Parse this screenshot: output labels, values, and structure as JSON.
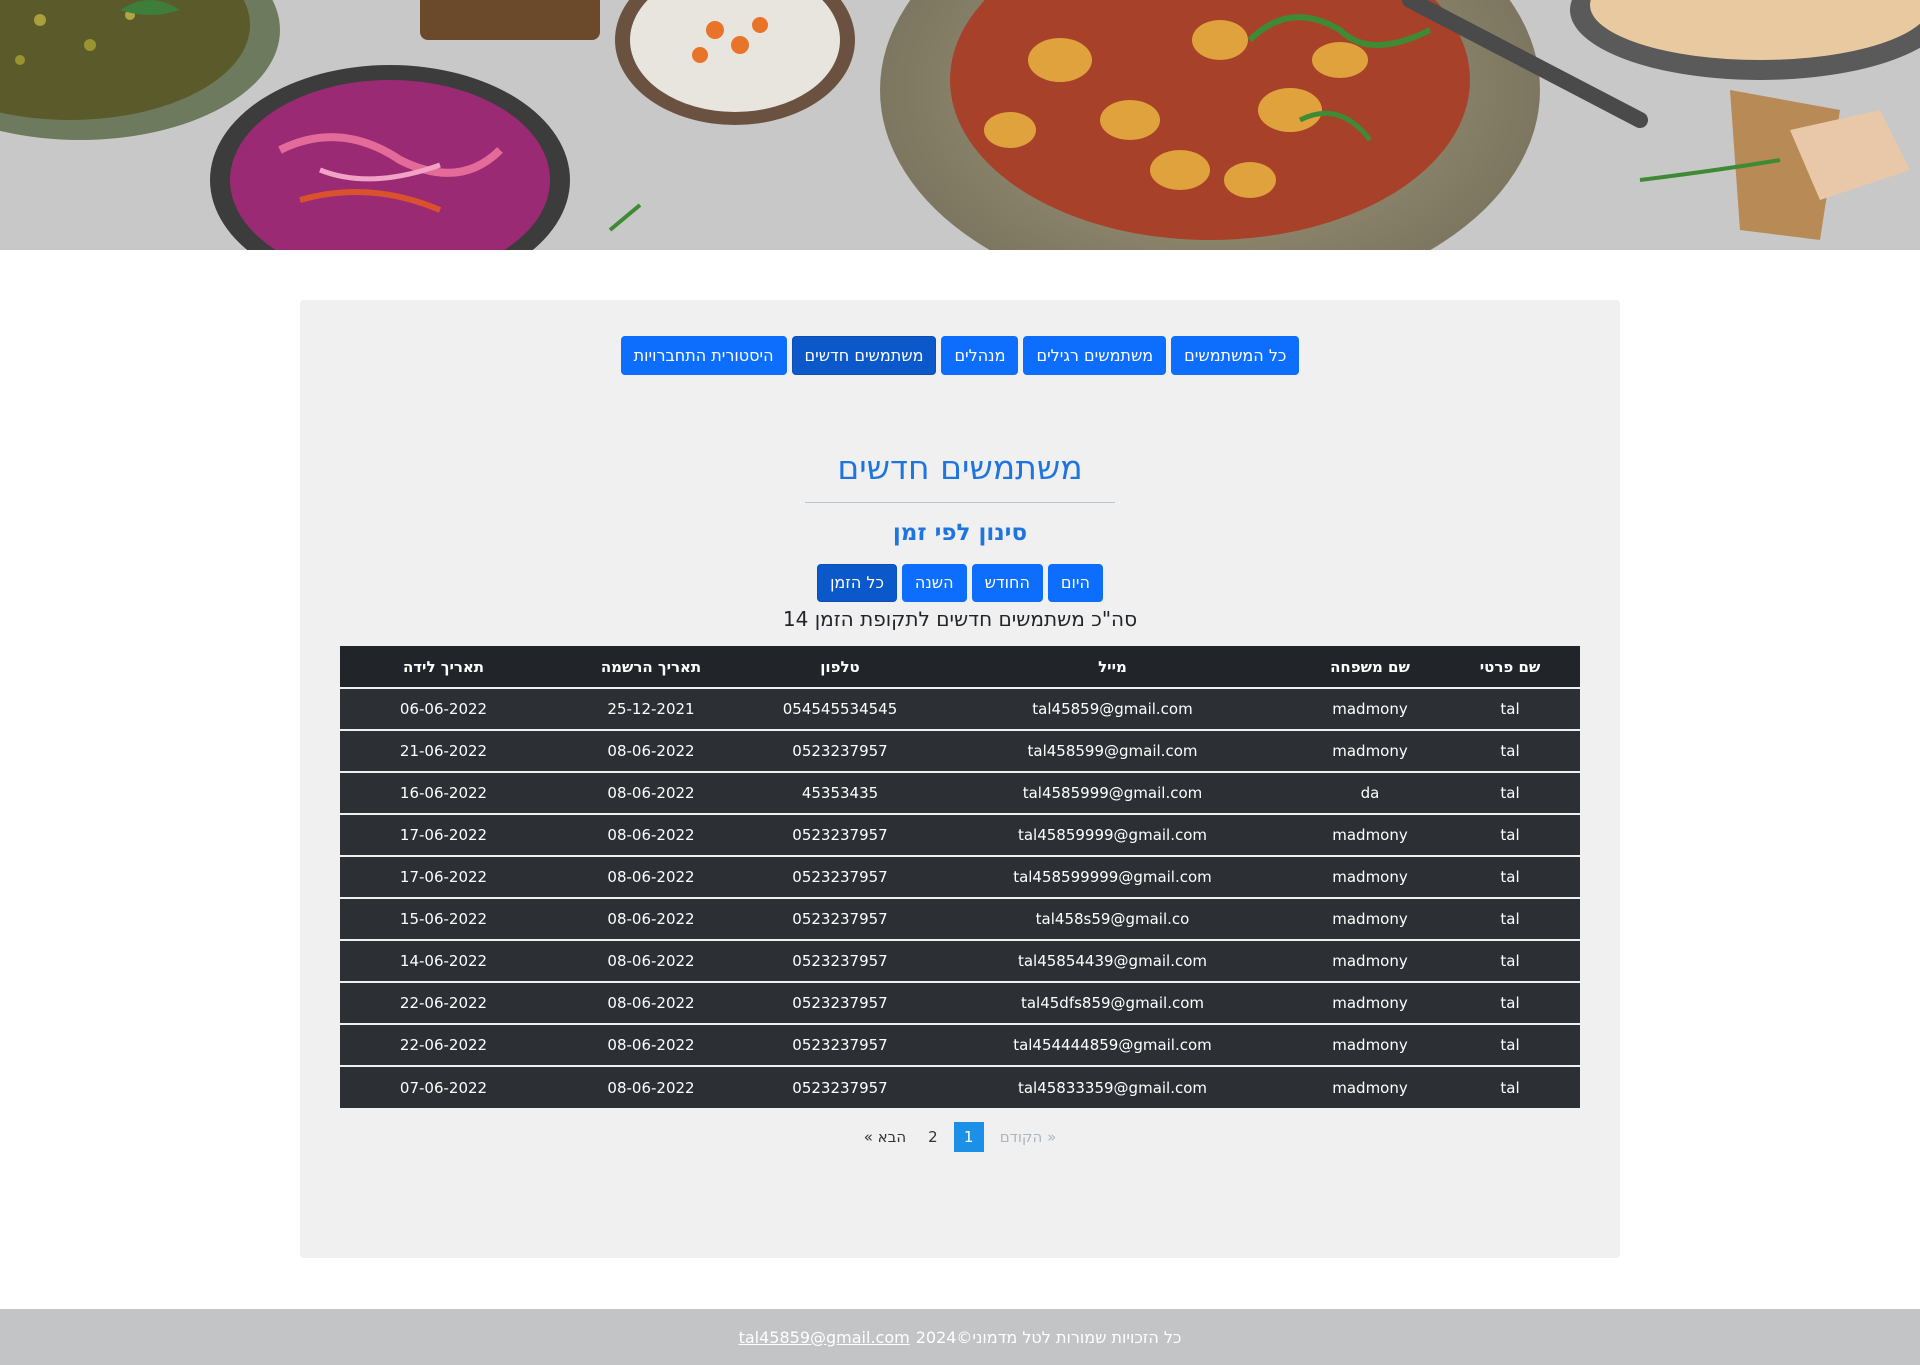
{
  "nav": {
    "items": [
      {
        "label": "כל המשתמשים",
        "active": false
      },
      {
        "label": "משתמשים רגילים",
        "active": false
      },
      {
        "label": "מנהלים",
        "active": false
      },
      {
        "label": "משתמשים חדשים",
        "active": true
      },
      {
        "label": "היסטורית התחברויות",
        "active": false
      }
    ]
  },
  "main": {
    "title": "משתמשים חדשים",
    "filter_title": "סינון לפי זמן",
    "filters": [
      {
        "label": "היום",
        "active": false
      },
      {
        "label": "החודש",
        "active": false
      },
      {
        "label": "השנה",
        "active": false
      },
      {
        "label": "כל הזמן",
        "active": true
      }
    ],
    "summary": "סה\"כ משתמשים חדשים לתקופת הזמן 14"
  },
  "table": {
    "headers": [
      "שם פרטי",
      "שם משפחה",
      "מייל",
      "טלפון",
      "תאריך הרשמה",
      "תאריך לידה"
    ],
    "rows": [
      [
        "tal",
        "madmony",
        "tal45859@gmail.com",
        "054545534545",
        "25-12-2021",
        "06-06-2022"
      ],
      [
        "tal",
        "madmony",
        "tal458599@gmail.com",
        "0523237957",
        "08-06-2022",
        "21-06-2022"
      ],
      [
        "tal",
        "da",
        "tal4585999@gmail.com",
        "45353435",
        "08-06-2022",
        "16-06-2022"
      ],
      [
        "tal",
        "madmony",
        "tal45859999@gmail.com",
        "0523237957",
        "08-06-2022",
        "17-06-2022"
      ],
      [
        "tal",
        "madmony",
        "tal458599999@gmail.com",
        "0523237957",
        "08-06-2022",
        "17-06-2022"
      ],
      [
        "tal",
        "madmony",
        "tal458s59@gmail.co",
        "0523237957",
        "08-06-2022",
        "15-06-2022"
      ],
      [
        "tal",
        "madmony",
        "tal45854439@gmail.com",
        "0523237957",
        "08-06-2022",
        "14-06-2022"
      ],
      [
        "tal",
        "madmony",
        "tal45dfs859@gmail.com",
        "0523237957",
        "08-06-2022",
        "22-06-2022"
      ],
      [
        "tal",
        "madmony",
        "tal454444859@gmail.com",
        "0523237957",
        "08-06-2022",
        "22-06-2022"
      ],
      [
        "tal",
        "madmony",
        "tal45833359@gmail.com",
        "0523237957",
        "08-06-2022",
        "07-06-2022"
      ]
    ]
  },
  "pagination": {
    "prev_label": "« הקודם",
    "pages": [
      "1",
      "2"
    ],
    "current_page": "1",
    "next_label": "הבא »"
  },
  "footer": {
    "text": "כל הזכויות שמורות לטל מדמוני©2024",
    "email": "tal45859@gmail.com"
  },
  "colors": {
    "primary": "#0d6efd",
    "primary_active": "#0a58ca",
    "title_blue": "#1f75e0",
    "table_dark": "#212529",
    "table_row": "#2c3034",
    "panel_bg": "#f0f0f1",
    "footer_bg": "#c3c4c6",
    "page_current": "#1c8fe6"
  }
}
